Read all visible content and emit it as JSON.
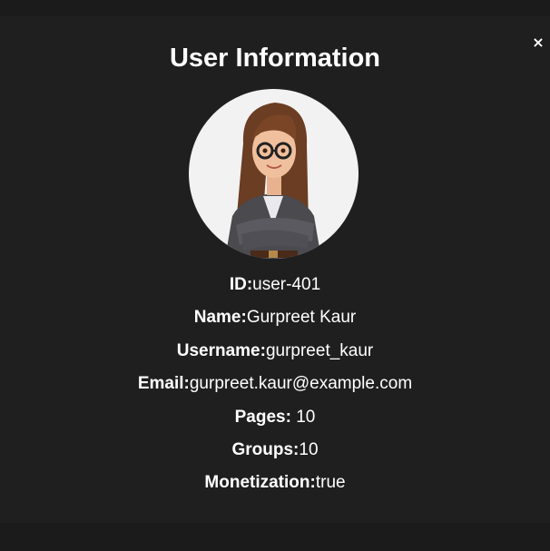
{
  "modal": {
    "title": "User Information",
    "close_label": "×"
  },
  "avatar": {
    "icon": "user-avatar-illustration"
  },
  "fields": {
    "id": {
      "label": "ID:",
      "value": "user-401"
    },
    "name": {
      "label": "Name:",
      "value": "Gurpreet Kaur"
    },
    "username": {
      "label": "Username:",
      "value": "gurpreet_kaur"
    },
    "email": {
      "label": "Email:",
      "value": "gurpreet.kaur@example.com"
    },
    "pages": {
      "label": "Pages:",
      "value": " 10"
    },
    "groups": {
      "label": "Groups:",
      "value": "10"
    },
    "monetization": {
      "label": "Monetization:",
      "value": "true"
    }
  },
  "colors": {
    "background": "#1b1b1b",
    "modal_background": "#1f1f1f",
    "text": "#ffffff",
    "avatar_background": "#f2f2f2"
  }
}
